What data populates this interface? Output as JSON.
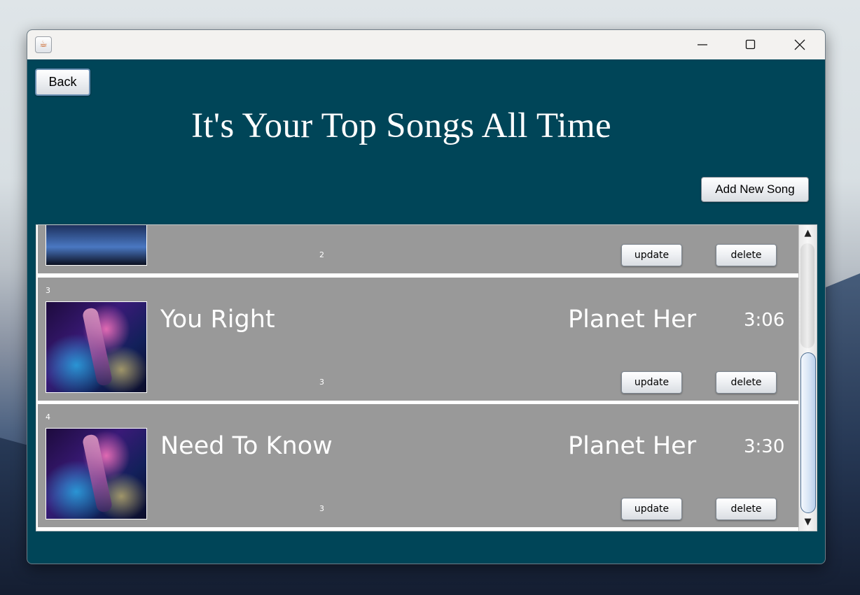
{
  "window": {
    "app_icon": "java-cup-icon",
    "controls": [
      "minimize-icon",
      "maximize-icon",
      "close-icon"
    ]
  },
  "header": {
    "back_label": "Back",
    "title": "It's Your Top Songs All Time",
    "add_label": "Add New Song"
  },
  "songs": [
    {
      "number": "",
      "title": "",
      "album": "",
      "duration": "",
      "rank": "2",
      "update_label": "update",
      "delete_label": "delete"
    },
    {
      "number": "3",
      "title": "You Right",
      "album": "Planet Her",
      "duration": "3:06",
      "rank": "3",
      "update_label": "update",
      "delete_label": "delete"
    },
    {
      "number": "4",
      "title": "Need To Know",
      "album": "Planet Her",
      "duration": "3:30",
      "rank": "3",
      "update_label": "update",
      "delete_label": "delete"
    }
  ],
  "scrollbar": {
    "up_icon": "scroll-up-arrow-icon",
    "down_icon": "scroll-down-arrow-icon"
  },
  "colors": {
    "window_bg": "#004558",
    "row_bg": "#999999",
    "title_text": "#ffffff"
  }
}
